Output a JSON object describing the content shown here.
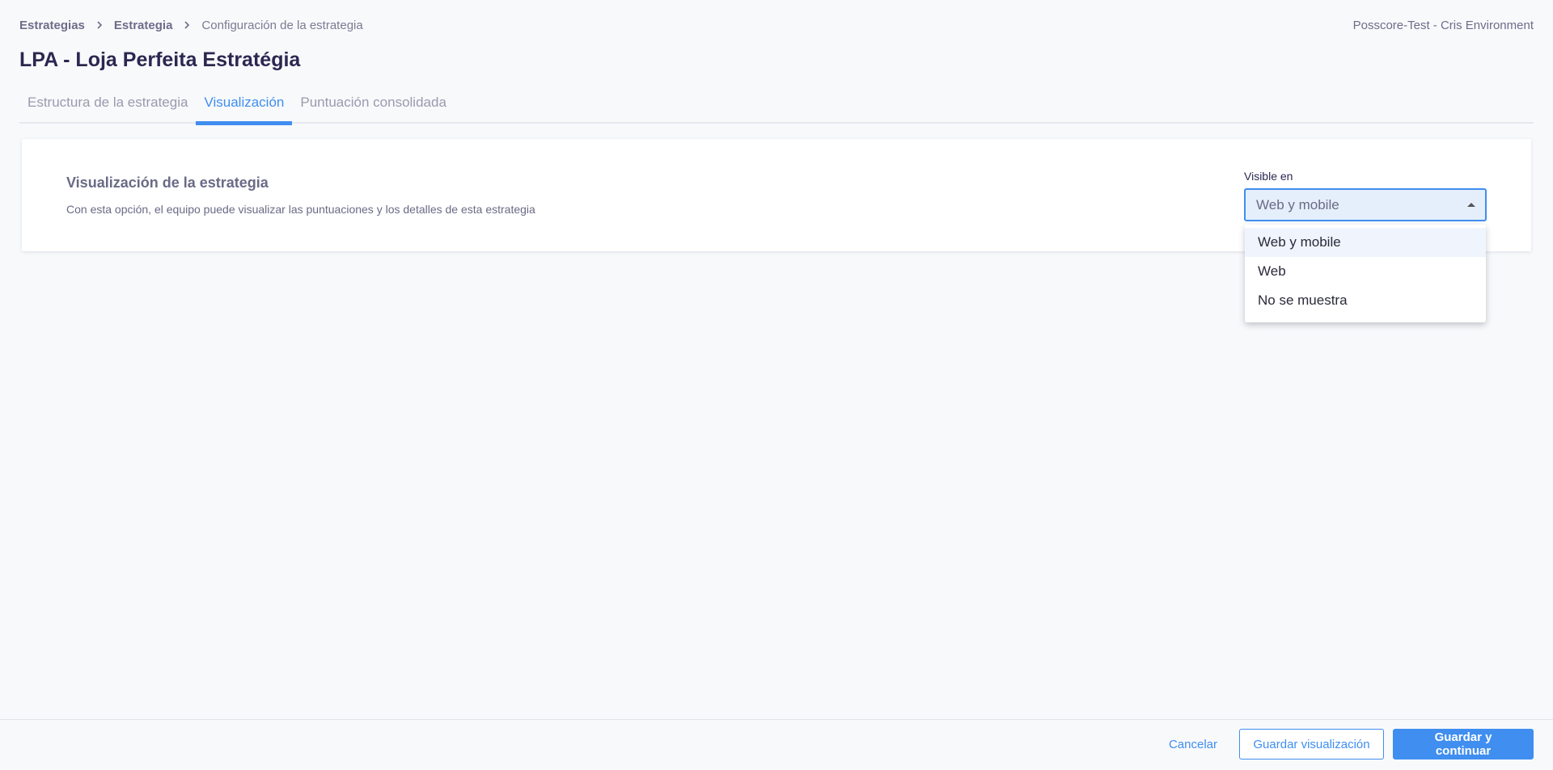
{
  "breadcrumb": {
    "items": [
      "Estrategias",
      "Estrategia",
      "Configuración de la estrategia"
    ]
  },
  "environment": "Posscore-Test - Cris Environment",
  "page_title": "LPA - Loja Perfeita Estratégia",
  "tabs": [
    {
      "label": "Estructura de la estrategia",
      "active": false
    },
    {
      "label": "Visualización",
      "active": true
    },
    {
      "label": "Puntuación consolidada",
      "active": false
    }
  ],
  "card": {
    "title": "Visualización de la estrategia",
    "description": "Con esta opción, el equipo puede visualizar las puntuaciones y los detalles de esta estrategia"
  },
  "visibility_field": {
    "label": "Visible en",
    "value": "Web y mobile",
    "options": [
      "Web y mobile",
      "Web",
      "No se muestra"
    ]
  },
  "footer": {
    "cancel_label": "Cancelar",
    "save_view_label": "Guardar visualización",
    "save_continue_label": "Guardar y continuar"
  },
  "colors": {
    "accent": "#3f8ef0",
    "background": "#f8f9fb",
    "title": "#2a2850"
  },
  "icons": [
    "chevron-right-icon",
    "caret-up-icon"
  ]
}
